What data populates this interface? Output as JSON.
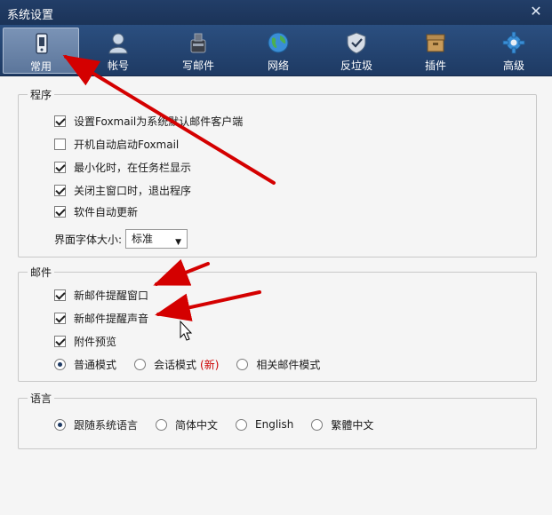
{
  "window": {
    "title": "系统设置",
    "close_glyph": "✕"
  },
  "toolbar": {
    "items": [
      {
        "label": "常用",
        "icon": "phone-device-icon",
        "active": true
      },
      {
        "label": "帐号",
        "icon": "user-account-icon"
      },
      {
        "label": "写邮件",
        "icon": "compose-ink-icon"
      },
      {
        "label": "网络",
        "icon": "globe-network-icon"
      },
      {
        "label": "反垃圾",
        "icon": "shield-antispam-icon"
      },
      {
        "label": "插件",
        "icon": "plugin-box-icon"
      },
      {
        "label": "高级",
        "icon": "gear-advanced-icon"
      }
    ]
  },
  "program": {
    "legend": "程序",
    "options": [
      {
        "label": "设置Foxmail为系统默认邮件客户端",
        "checked": true
      },
      {
        "label": "开机自动启动Foxmail",
        "checked": false
      },
      {
        "label": "最小化时，在任务栏显示",
        "checked": true
      },
      {
        "label": "关闭主窗口时，退出程序",
        "checked": true
      },
      {
        "label": "软件自动更新",
        "checked": true
      }
    ],
    "font_size_label": "界面字体大小:",
    "font_size_value": "标准"
  },
  "mail": {
    "legend": "邮件",
    "options": [
      {
        "label": "新邮件提醒窗口",
        "checked": true
      },
      {
        "label": "新邮件提醒声音",
        "checked": true
      },
      {
        "label": "附件预览",
        "checked": true
      }
    ],
    "modes": [
      {
        "label": "普通模式",
        "selected": true
      },
      {
        "label": "会话模式",
        "tag": "(新)",
        "selected": false
      },
      {
        "label": "相关邮件模式",
        "selected": false
      }
    ]
  },
  "language": {
    "legend": "语言",
    "options": [
      {
        "label": "跟随系统语言",
        "selected": true
      },
      {
        "label": "简体中文",
        "selected": false
      },
      {
        "label": "English",
        "selected": false
      },
      {
        "label": "繁體中文",
        "selected": false
      }
    ]
  },
  "colors": {
    "titlebar": "#1b3358",
    "toolbar": "#2b4f80",
    "arrow": "#d40000",
    "new_tag": "#cc0000"
  }
}
